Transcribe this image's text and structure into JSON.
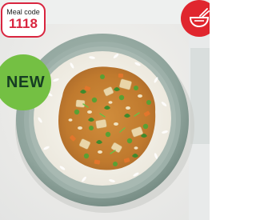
{
  "meal_badge": {
    "label": "Meal code",
    "code": "1118"
  },
  "new_badge": {
    "label": "NEW"
  },
  "photo": {
    "icon": "meal-photo"
  },
  "corner_icon": {
    "icon": "bowl-icon",
    "color": "#e0262e"
  },
  "colors": {
    "brand_red": "#d9253f",
    "new_green": "#74c043"
  }
}
